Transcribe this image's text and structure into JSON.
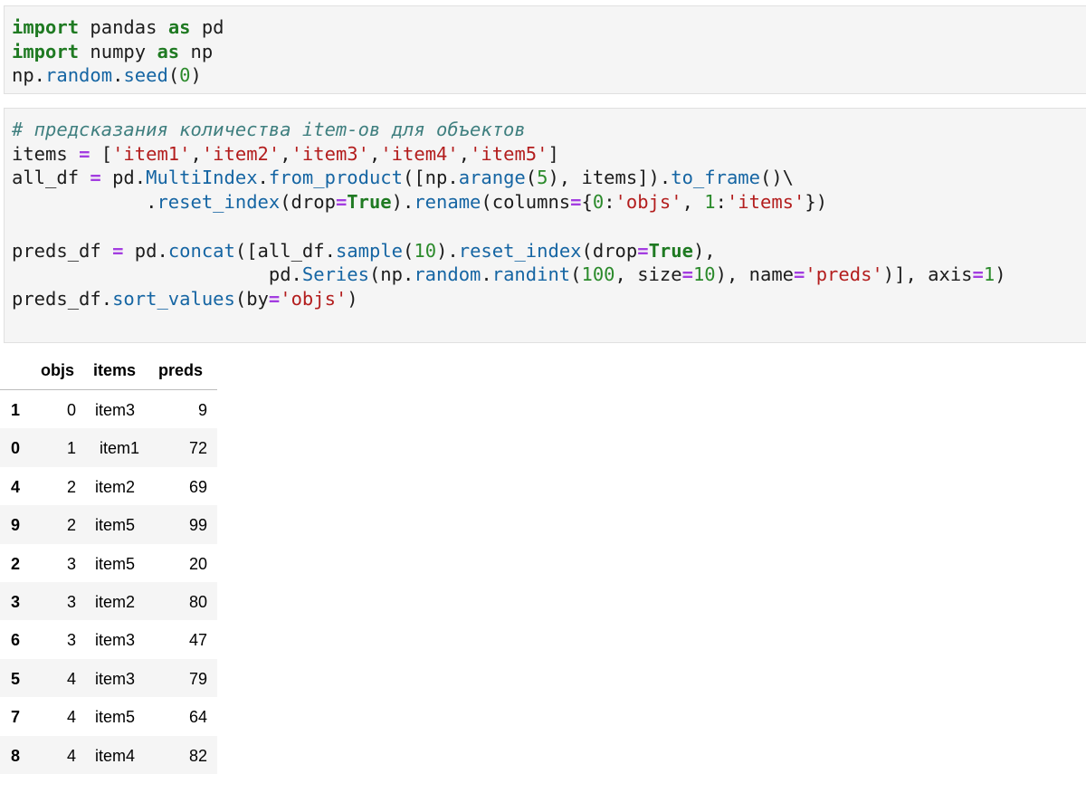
{
  "cells": [
    {
      "lines": [
        [
          {
            "t": "kw",
            "v": "import"
          },
          {
            "t": "",
            "v": " pandas "
          },
          {
            "t": "kw",
            "v": "as"
          },
          {
            "t": "",
            "v": " pd"
          }
        ],
        [
          {
            "t": "kw",
            "v": "import"
          },
          {
            "t": "",
            "v": " numpy "
          },
          {
            "t": "kw",
            "v": "as"
          },
          {
            "t": "",
            "v": " np"
          }
        ],
        [
          {
            "t": "",
            "v": "np."
          },
          {
            "t": "attr",
            "v": "random"
          },
          {
            "t": "",
            "v": "."
          },
          {
            "t": "attr",
            "v": "seed"
          },
          {
            "t": "",
            "v": "("
          },
          {
            "t": "num",
            "v": "0"
          },
          {
            "t": "",
            "v": ")"
          }
        ]
      ]
    },
    {
      "lines": [
        [
          {
            "t": "cm",
            "v": "# предсказания количества item-ов для объектов"
          }
        ],
        [
          {
            "t": "",
            "v": "items "
          },
          {
            "t": "op",
            "v": "="
          },
          {
            "t": "",
            "v": " ["
          },
          {
            "t": "str",
            "v": "'item1'"
          },
          {
            "t": "",
            "v": ","
          },
          {
            "t": "str",
            "v": "'item2'"
          },
          {
            "t": "",
            "v": ","
          },
          {
            "t": "str",
            "v": "'item3'"
          },
          {
            "t": "",
            "v": ","
          },
          {
            "t": "str",
            "v": "'item4'"
          },
          {
            "t": "",
            "v": ","
          },
          {
            "t": "str",
            "v": "'item5'"
          },
          {
            "t": "",
            "v": "]"
          }
        ],
        [
          {
            "t": "",
            "v": "all_df "
          },
          {
            "t": "op",
            "v": "="
          },
          {
            "t": "",
            "v": " pd."
          },
          {
            "t": "attr",
            "v": "MultiIndex"
          },
          {
            "t": "",
            "v": "."
          },
          {
            "t": "attr",
            "v": "from_product"
          },
          {
            "t": "",
            "v": "([np."
          },
          {
            "t": "attr",
            "v": "arange"
          },
          {
            "t": "",
            "v": "("
          },
          {
            "t": "num",
            "v": "5"
          },
          {
            "t": "",
            "v": "), items])."
          },
          {
            "t": "attr",
            "v": "to_frame"
          },
          {
            "t": "",
            "v": "()\\"
          }
        ],
        [
          {
            "t": "",
            "v": "            ."
          },
          {
            "t": "attr",
            "v": "reset_index"
          },
          {
            "t": "",
            "v": "(drop"
          },
          {
            "t": "op",
            "v": "="
          },
          {
            "t": "const",
            "v": "True"
          },
          {
            "t": "",
            "v": ")."
          },
          {
            "t": "attr",
            "v": "rename"
          },
          {
            "t": "",
            "v": "(columns"
          },
          {
            "t": "op",
            "v": "="
          },
          {
            "t": "",
            "v": "{"
          },
          {
            "t": "num",
            "v": "0"
          },
          {
            "t": "",
            "v": ":"
          },
          {
            "t": "str",
            "v": "'objs'"
          },
          {
            "t": "",
            "v": ", "
          },
          {
            "t": "num",
            "v": "1"
          },
          {
            "t": "",
            "v": ":"
          },
          {
            "t": "str",
            "v": "'items'"
          },
          {
            "t": "",
            "v": "})"
          }
        ],
        [
          {
            "t": "",
            "v": ""
          }
        ],
        [
          {
            "t": "",
            "v": "preds_df "
          },
          {
            "t": "op",
            "v": "="
          },
          {
            "t": "",
            "v": " pd."
          },
          {
            "t": "attr",
            "v": "concat"
          },
          {
            "t": "",
            "v": "([all_df."
          },
          {
            "t": "attr",
            "v": "sample"
          },
          {
            "t": "",
            "v": "("
          },
          {
            "t": "num",
            "v": "10"
          },
          {
            "t": "",
            "v": ")."
          },
          {
            "t": "attr",
            "v": "reset_index"
          },
          {
            "t": "",
            "v": "(drop"
          },
          {
            "t": "op",
            "v": "="
          },
          {
            "t": "const",
            "v": "True"
          },
          {
            "t": "",
            "v": "),"
          }
        ],
        [
          {
            "t": "",
            "v": "                       pd."
          },
          {
            "t": "attr",
            "v": "Series"
          },
          {
            "t": "",
            "v": "(np."
          },
          {
            "t": "attr",
            "v": "random"
          },
          {
            "t": "",
            "v": "."
          },
          {
            "t": "attr",
            "v": "randint"
          },
          {
            "t": "",
            "v": "("
          },
          {
            "t": "num",
            "v": "100"
          },
          {
            "t": "",
            "v": ", size"
          },
          {
            "t": "op",
            "v": "="
          },
          {
            "t": "num",
            "v": "10"
          },
          {
            "t": "",
            "v": "), name"
          },
          {
            "t": "op",
            "v": "="
          },
          {
            "t": "str",
            "v": "'preds'"
          },
          {
            "t": "",
            "v": ")], axis"
          },
          {
            "t": "op",
            "v": "="
          },
          {
            "t": "num",
            "v": "1"
          },
          {
            "t": "",
            "v": ")"
          }
        ],
        [
          {
            "t": "",
            "v": "preds_df."
          },
          {
            "t": "attr",
            "v": "sort_values"
          },
          {
            "t": "",
            "v": "(by"
          },
          {
            "t": "op",
            "v": "="
          },
          {
            "t": "str",
            "v": "'objs'"
          },
          {
            "t": "",
            "v": ")"
          }
        ]
      ]
    }
  ],
  "table": {
    "headers": {
      "objs": "objs",
      "items": "items",
      "preds": "preds"
    },
    "rows": [
      {
        "idx": "1",
        "objs": "0",
        "items": "item3",
        "preds": "9"
      },
      {
        "idx": "0",
        "objs": "1",
        "items": "item1",
        "preds": "72"
      },
      {
        "idx": "4",
        "objs": "2",
        "items": "item2",
        "preds": "69"
      },
      {
        "idx": "9",
        "objs": "2",
        "items": "item5",
        "preds": "99"
      },
      {
        "idx": "2",
        "objs": "3",
        "items": "item5",
        "preds": "20"
      },
      {
        "idx": "3",
        "objs": "3",
        "items": "item2",
        "preds": "80"
      },
      {
        "idx": "6",
        "objs": "3",
        "items": "item3",
        "preds": "47"
      },
      {
        "idx": "5",
        "objs": "4",
        "items": "item3",
        "preds": "79"
      },
      {
        "idx": "7",
        "objs": "4",
        "items": "item5",
        "preds": "64"
      },
      {
        "idx": "8",
        "objs": "4",
        "items": "item4",
        "preds": "82"
      }
    ]
  }
}
